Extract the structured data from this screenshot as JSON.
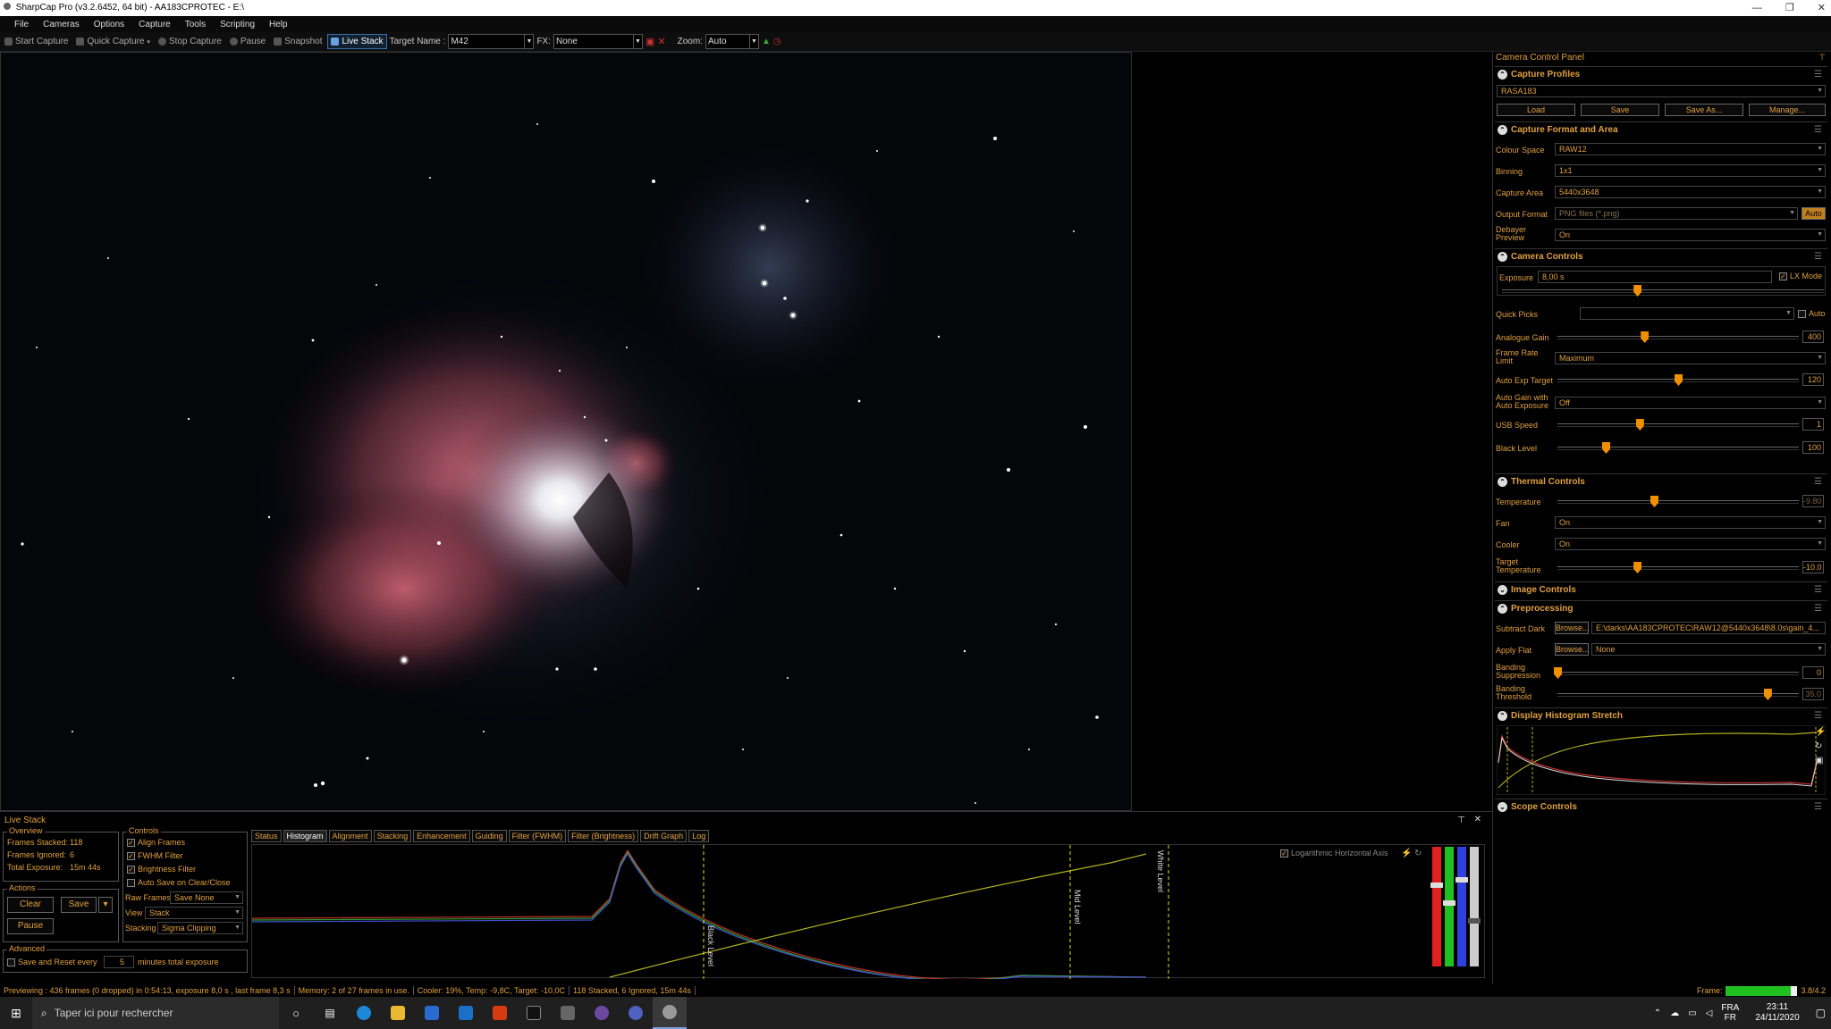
{
  "window": {
    "title": "SharpCap Pro (v3.2.6452, 64 bit) - AA183CPROTEC - E:\\",
    "controls": [
      "—",
      "❐",
      "✕"
    ]
  },
  "menu": [
    "File",
    "Cameras",
    "Options",
    "Capture",
    "Tools",
    "Scripting",
    "Help"
  ],
  "toolbar": {
    "start_capture": "Start Capture",
    "quick_capture": "Quick Capture",
    "stop_capture": "Stop Capture",
    "pause": "Pause",
    "snapshot": "Snapshot",
    "live_stack": "Live Stack",
    "target_label": "Target Name :",
    "target_value": "M42",
    "fx_label": "FX:",
    "fx_value": "None",
    "zoom_label": "Zoom:",
    "zoom_value": "Auto"
  },
  "panel": {
    "title": "Camera Control Panel",
    "capture_profiles": {
      "title": "Capture Profiles",
      "profile": "RASA183",
      "buttons": [
        "Load",
        "Save",
        "Save As...",
        "Manage..."
      ]
    },
    "capture_format": {
      "title": "Capture Format and Area",
      "colour_space_label": "Colour Space",
      "colour_space": "RAW12",
      "binning_label": "Binning",
      "binning": "1x1",
      "capture_area_label": "Capture Area",
      "capture_area": "5440x3648",
      "output_format_label": "Output Format",
      "output_format": "PNG files (*.png)",
      "auto_label": "Auto",
      "debayer_label": "Debayer Preview",
      "debayer": "On"
    },
    "camera_controls": {
      "title": "Camera Controls",
      "exposure_label": "Exposure",
      "exposure": "8,00 s",
      "lx_mode": "LX Mode",
      "exposure_level": 0.42,
      "quick_picks_label": "Quick Picks",
      "auto_label": "Auto",
      "sliders": [
        {
          "label": "Analogue Gain",
          "value": "400",
          "level": 0.36
        },
        {
          "label": "Auto Exp Target",
          "value": "120",
          "level": 0.5
        },
        {
          "label": "USB Speed",
          "value": "1",
          "level": 0.34
        },
        {
          "label": "Black Level",
          "value": "100",
          "level": 0.2
        }
      ],
      "frame_rate_label": "Frame Rate Limit",
      "frame_rate": "Maximum",
      "auto_gain_label": "Auto Gain with Auto Exposure",
      "auto_gain": "Off"
    },
    "thermal": {
      "title": "Thermal Controls",
      "temperature_label": "Temperature",
      "temperature": "-9.80",
      "temperature_level": 0.4,
      "fan_label": "Fan",
      "fan": "On",
      "cooler_label": "Cooler",
      "cooler": "On",
      "target_temp_label": "Target Temperature",
      "target_temp": "-10.0",
      "target_temp_level": 0.33
    },
    "image_controls": {
      "title": "Image Controls"
    },
    "preprocessing": {
      "title": "Preprocessing",
      "subtract_dark_label": "Subtract Dark",
      "browse": "Browse...",
      "dark_file": "E:\\darks\\AA183CPROTEC\\RAW12@5440x3648\\8.0s\\gain_4...",
      "apply_flat_label": "Apply Flat",
      "flat_file": "None",
      "banding_supp_label": "Banding Suppression",
      "banding_supp": "0",
      "banding_supp_level": 0.0,
      "banding_thr_label": "Banding Threshold",
      "banding_thr": "35.0",
      "banding_thr_level": 0.87
    },
    "display_histogram": {
      "title": "Display Histogram Stretch"
    },
    "scope_controls": {
      "title": "Scope Controls"
    }
  },
  "livestack": {
    "title": "Live Stack",
    "overview": {
      "title": "Overview",
      "frames_stacked_label": "Frames Stacked:",
      "frames_stacked": "118",
      "frames_ignored_label": "Frames Ignored:",
      "frames_ignored": "6",
      "total_exposure_label": "Total Exposure:",
      "total_exposure": "15m 44s"
    },
    "actions": {
      "title": "Actions",
      "clear": "Clear",
      "save": "Save",
      "pause": "Pause"
    },
    "controls": {
      "title": "Controls",
      "align": "Align Frames",
      "fwhm": "FWHM Filter",
      "brightness": "Brightness Filter",
      "autosave": "Auto Save on Clear/Close",
      "raw_frames_label": "Raw Frames",
      "raw_frames": "Save None",
      "view_label": "View",
      "view": "Stack",
      "stacking_label": "Stacking",
      "stacking": "Sigma Clipping"
    },
    "advanced": {
      "title": "Advanced",
      "save_reset": "Save and Reset every",
      "minutes": "5",
      "minutes_label": "minutes total exposure"
    },
    "tabs": [
      "Status",
      "Histogram",
      "Alignment",
      "Stacking",
      "Enhancement",
      "Guiding",
      "Filter (FWHM)",
      "Filter (Brightness)",
      "Drift Graph",
      "Log"
    ],
    "histogram": {
      "log_label": "Logarithmic Horizontal Axis",
      "black_level": "Black Level",
      "mid_level": "Mid Level",
      "white_level": "White Level"
    }
  },
  "status": {
    "previewing": "Previewing : 436 frames (0 dropped) in 0:54:13, exposure 8,0 s , last frame 8,3 s",
    "memory": "Memory: 2 of 27 frames in use.",
    "cooler": "Cooler: 19%, Temp: -9,8C, Target: -10,0C",
    "stacked": "118 Stacked, 6 Ignored, 15m 44s",
    "frame_label": "Frame:",
    "frame_value": "3.8/4.2"
  },
  "taskbar": {
    "search_placeholder": "Taper ici pour rechercher",
    "lang": "FRA",
    "lang2": "FR",
    "time": "23:11",
    "date": "24/11/2020"
  },
  "colors": {
    "accent": "#e0a040",
    "panel_bg": "#000000",
    "nebula": "#c05a6a"
  }
}
